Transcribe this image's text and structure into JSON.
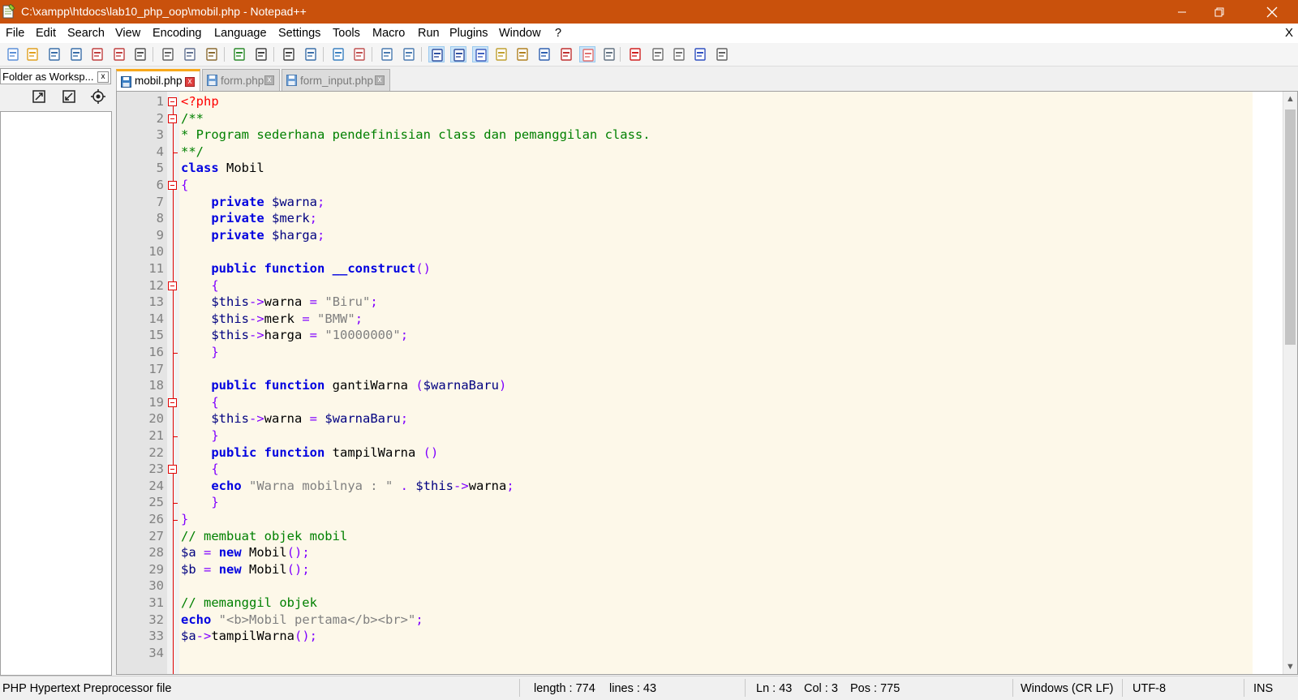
{
  "window": {
    "title": "C:\\xampp\\htdocs\\lab10_php_oop\\mobil.php - Notepad++",
    "colors": {
      "titlebar": "#c9510c",
      "code_bg": "#fdf8e9",
      "keyword": "#0000e0",
      "operator": "#8000ff",
      "comment": "#008000",
      "string": "#808080",
      "fold_marker": "#e00000"
    }
  },
  "menu": [
    "File",
    "Edit",
    "Search",
    "View",
    "Encoding",
    "Language",
    "Settings",
    "Tools",
    "Macro",
    "Run",
    "Plugins",
    "Window",
    "?"
  ],
  "menu_close": "X",
  "toolbar_icons": [
    "new-file-icon",
    "open-file-icon",
    "save-icon",
    "save-all-icon",
    "close-icon",
    "close-all-icon",
    "print-icon",
    "cut-icon",
    "copy-icon",
    "paste-icon",
    "undo-icon",
    "redo-icon",
    "find-icon",
    "replace-icon",
    "zoom-in-icon",
    "zoom-out-icon",
    "sync-vertical-icon",
    "sync-horizontal-icon",
    "word-wrap-icon",
    "show-all-chars-icon",
    "indent-guide-icon",
    "user-language-icon",
    "document-map-icon",
    "function-list-icon",
    "doc-list-icon",
    "folder-workspace-icon",
    "monitoring-icon",
    "record-macro-icon",
    "stop-record-icon",
    "play-macro-icon",
    "run-macro-multiple-icon",
    "save-macro-icon"
  ],
  "panel": {
    "title": "Folder as Worksp...",
    "close": "x",
    "buttons": [
      "unfold-all-icon",
      "fold-all-icon",
      "locate-file-icon"
    ]
  },
  "tabs": [
    {
      "label": "mobil.php",
      "active": true
    },
    {
      "label": "form.php",
      "active": false
    },
    {
      "label": "form_input.php",
      "active": false
    }
  ],
  "editor": {
    "lines": [
      [
        [
          "ph",
          "<?php"
        ]
      ],
      [
        [
          "cm",
          "/**"
        ]
      ],
      [
        [
          "cm",
          "* Program sederhana pendefinisian class dan pemanggilan class."
        ]
      ],
      [
        [
          "cm",
          "**/"
        ]
      ],
      [
        [
          "kw",
          "class"
        ],
        [
          "tx",
          " Mobil"
        ]
      ],
      [
        [
          "op",
          "{"
        ]
      ],
      [
        [
          "tx",
          "    "
        ],
        [
          "kw",
          "private"
        ],
        [
          "tx",
          " "
        ],
        [
          "vr",
          "$warna"
        ],
        [
          "op",
          ";"
        ]
      ],
      [
        [
          "tx",
          "    "
        ],
        [
          "kw",
          "private"
        ],
        [
          "tx",
          " "
        ],
        [
          "vr",
          "$merk"
        ],
        [
          "op",
          ";"
        ]
      ],
      [
        [
          "tx",
          "    "
        ],
        [
          "kw",
          "private"
        ],
        [
          "tx",
          " "
        ],
        [
          "vr",
          "$harga"
        ],
        [
          "op",
          ";"
        ]
      ],
      [],
      [
        [
          "tx",
          "    "
        ],
        [
          "kw",
          "public"
        ],
        [
          "tx",
          " "
        ],
        [
          "kw",
          "function"
        ],
        [
          "tx",
          " "
        ],
        [
          "kw",
          "__construct"
        ],
        [
          "op",
          "()"
        ]
      ],
      [
        [
          "tx",
          "    "
        ],
        [
          "op",
          "{"
        ]
      ],
      [
        [
          "tx",
          "    "
        ],
        [
          "vr",
          "$this"
        ],
        [
          "op",
          "->"
        ],
        [
          "tx",
          "warna "
        ],
        [
          "op",
          "="
        ],
        [
          "tx",
          " "
        ],
        [
          "st",
          "\"Biru\""
        ],
        [
          "op",
          ";"
        ]
      ],
      [
        [
          "tx",
          "    "
        ],
        [
          "vr",
          "$this"
        ],
        [
          "op",
          "->"
        ],
        [
          "tx",
          "merk "
        ],
        [
          "op",
          "="
        ],
        [
          "tx",
          " "
        ],
        [
          "st",
          "\"BMW\""
        ],
        [
          "op",
          ";"
        ]
      ],
      [
        [
          "tx",
          "    "
        ],
        [
          "vr",
          "$this"
        ],
        [
          "op",
          "->"
        ],
        [
          "tx",
          "harga "
        ],
        [
          "op",
          "="
        ],
        [
          "tx",
          " "
        ],
        [
          "st",
          "\"10000000\""
        ],
        [
          "op",
          ";"
        ]
      ],
      [
        [
          "tx",
          "    "
        ],
        [
          "op",
          "}"
        ]
      ],
      [],
      [
        [
          "tx",
          "    "
        ],
        [
          "kw",
          "public"
        ],
        [
          "tx",
          " "
        ],
        [
          "kw",
          "function"
        ],
        [
          "tx",
          " gantiWarna "
        ],
        [
          "op",
          "("
        ],
        [
          "vr",
          "$warnaBaru"
        ],
        [
          "op",
          ")"
        ]
      ],
      [
        [
          "tx",
          "    "
        ],
        [
          "op",
          "{"
        ]
      ],
      [
        [
          "tx",
          "    "
        ],
        [
          "vr",
          "$this"
        ],
        [
          "op",
          "->"
        ],
        [
          "tx",
          "warna "
        ],
        [
          "op",
          "="
        ],
        [
          "tx",
          " "
        ],
        [
          "vr",
          "$warnaBaru"
        ],
        [
          "op",
          ";"
        ]
      ],
      [
        [
          "tx",
          "    "
        ],
        [
          "op",
          "}"
        ]
      ],
      [
        [
          "tx",
          "    "
        ],
        [
          "kw",
          "public"
        ],
        [
          "tx",
          " "
        ],
        [
          "kw",
          "function"
        ],
        [
          "tx",
          " tampilWarna "
        ],
        [
          "op",
          "()"
        ]
      ],
      [
        [
          "tx",
          "    "
        ],
        [
          "op",
          "{"
        ]
      ],
      [
        [
          "tx",
          "    "
        ],
        [
          "kw",
          "echo"
        ],
        [
          "tx",
          " "
        ],
        [
          "st",
          "\"Warna mobilnya : \""
        ],
        [
          "tx",
          " "
        ],
        [
          "op",
          "."
        ],
        [
          "tx",
          " "
        ],
        [
          "vr",
          "$this"
        ],
        [
          "op",
          "->"
        ],
        [
          "tx",
          "warna"
        ],
        [
          "op",
          ";"
        ]
      ],
      [
        [
          "tx",
          "    "
        ],
        [
          "op",
          "}"
        ]
      ],
      [
        [
          "op",
          "}"
        ]
      ],
      [
        [
          "cm",
          "// membuat objek mobil"
        ]
      ],
      [
        [
          "vr",
          "$a"
        ],
        [
          "tx",
          " "
        ],
        [
          "op",
          "="
        ],
        [
          "tx",
          " "
        ],
        [
          "kw",
          "new"
        ],
        [
          "tx",
          " Mobil"
        ],
        [
          "op",
          "();"
        ]
      ],
      [
        [
          "vr",
          "$b"
        ],
        [
          "tx",
          " "
        ],
        [
          "op",
          "="
        ],
        [
          "tx",
          " "
        ],
        [
          "kw",
          "new"
        ],
        [
          "tx",
          " Mobil"
        ],
        [
          "op",
          "();"
        ]
      ],
      [],
      [
        [
          "cm",
          "// memanggil objek"
        ]
      ],
      [
        [
          "kw",
          "echo"
        ],
        [
          "tx",
          " "
        ],
        [
          "st",
          "\"<b>Mobil pertama</b><br>\""
        ],
        [
          "op",
          ";"
        ]
      ],
      [
        [
          "vr",
          "$a"
        ],
        [
          "op",
          "->"
        ],
        [
          "tx",
          "tampilWarna"
        ],
        [
          "op",
          "();"
        ]
      ],
      []
    ],
    "fold_open_lines": [
      1,
      2,
      6,
      12,
      19,
      23
    ],
    "fold_end_lines": [
      4,
      16,
      21,
      25,
      26
    ]
  },
  "status": {
    "file_type": "PHP Hypertext Preprocessor file",
    "length": "length : 774",
    "lines": "lines : 43",
    "ln": "Ln : 43",
    "col": "Col : 3",
    "pos": "Pos : 775",
    "eol": "Windows (CR LF)",
    "encoding": "UTF-8",
    "mode": "INS"
  }
}
